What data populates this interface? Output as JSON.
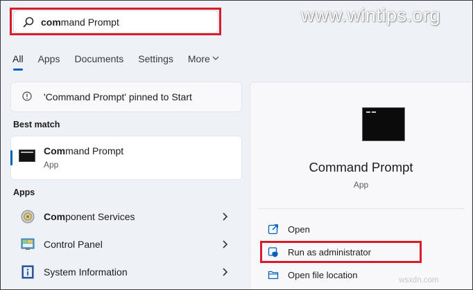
{
  "search": {
    "typed_bold": "com",
    "typed_rest": "mand Prompt"
  },
  "watermark": "www.wintips.org",
  "tabs": [
    {
      "label": "All",
      "active": true
    },
    {
      "label": "Apps"
    },
    {
      "label": "Documents"
    },
    {
      "label": "Settings"
    },
    {
      "label": "More"
    }
  ],
  "pinned_notice": "'Command Prompt' pinned to Start",
  "best_match": {
    "section_label": "Best match",
    "title_bold": "Com",
    "title_rest": "mand Prompt",
    "subtitle": "App"
  },
  "apps_section": {
    "label": "Apps",
    "items": [
      {
        "bold": "Com",
        "rest": "ponent Services",
        "icon": "component-services-icon"
      },
      {
        "bold": "",
        "rest": "Control Panel",
        "icon": "control-panel-icon"
      },
      {
        "bold": "",
        "rest": "System Information",
        "icon": "system-information-icon"
      }
    ]
  },
  "detail": {
    "title": "Command Prompt",
    "subtitle": "App",
    "actions": [
      {
        "label": "Open",
        "icon": "open-icon"
      },
      {
        "label": "Run as administrator",
        "icon": "shield-icon"
      },
      {
        "label": "Open file location",
        "icon": "folder-icon"
      }
    ]
  },
  "source_label": "wsxdn.com",
  "colors": {
    "accent": "#005fb8",
    "highlight": "#d91c2a"
  }
}
